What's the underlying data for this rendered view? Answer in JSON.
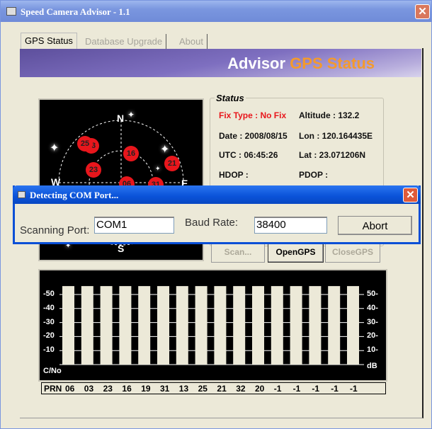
{
  "window": {
    "title": "Speed Camera Advisor - 1.1",
    "close": "✕"
  },
  "tabs": [
    {
      "label": "GPS Status"
    },
    {
      "label": "Database Upgrade"
    },
    {
      "label": "About"
    }
  ],
  "banner": {
    "part1": "Advisor",
    "part2": "GPS Status"
  },
  "skyplot": {
    "north": "N",
    "south": "S",
    "east": "E",
    "west": "W",
    "satellites": [
      {
        "prn": "03"
      },
      {
        "prn": "25"
      },
      {
        "prn": "16"
      },
      {
        "prn": "23"
      },
      {
        "prn": "21"
      },
      {
        "prn": "06"
      },
      {
        "prn": "31"
      }
    ]
  },
  "status": {
    "legend": "Status",
    "fix_type": "Fix Type : No Fix",
    "altitude": "Altitude : 132.2",
    "date": "Date : 2008/08/15",
    "lon": "Lon : 120.164435E",
    "utc": "UTC : 06:45:26",
    "lat": "Lat : 23.071206N",
    "hdop": "HDOP :",
    "pdop": "PDOP :"
  },
  "buttons": {
    "scan": "Scan...",
    "open": "OpenGPS",
    "close": "CloseGPS"
  },
  "signal": {
    "left_ticks": [
      "-50",
      "-40",
      "-30",
      "-20",
      "-10"
    ],
    "right_ticks": [
      "50-",
      "40-",
      "30-",
      "20-",
      "10-"
    ],
    "left_unit": "C/No",
    "right_unit": "dB",
    "prn_label": "PRN",
    "prns": [
      "06",
      "03",
      "23",
      "16",
      "19",
      "31",
      "13",
      "25",
      "21",
      "32",
      "20",
      "-1",
      "-1",
      "-1",
      "-1",
      "-1"
    ]
  },
  "dialog": {
    "title": "Detecting COM Port...",
    "close": "✕",
    "port_label": "Scanning Port:",
    "port_value": "COM1",
    "baud_label": "Baud Rate:",
    "baud_value": "38400",
    "abort": "Abort"
  },
  "colors": {
    "fix_red": "#e8161c",
    "accent_orange": "#f49a2c",
    "title_blue": "#0a52d8"
  }
}
